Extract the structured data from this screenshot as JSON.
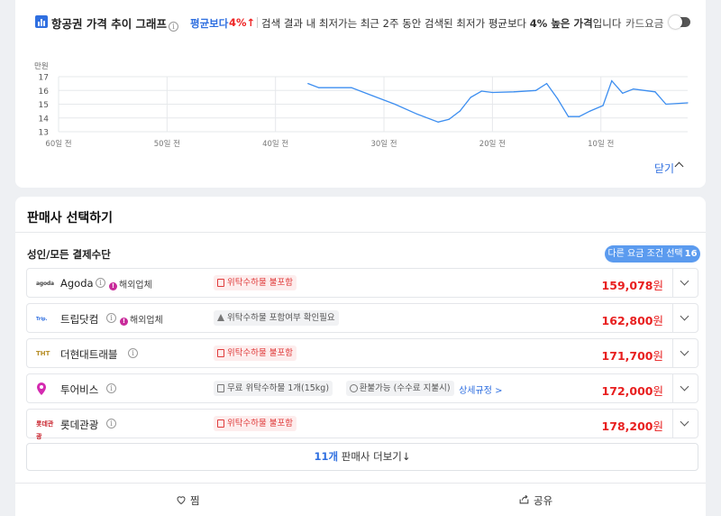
{
  "chart_section": {
    "title": "항공권 가격 추이 그래프",
    "compare_label": "평균보다",
    "compare_pct": "4%↑",
    "compare_desc_pre": "검색 결과 내 최저가는 최근 2주 동안 검색된 최저가 평균보다 ",
    "compare_desc_bold": "4% 높은 가격",
    "compare_desc_post": "입니다",
    "card_fee_label": "카드요금",
    "card_fee_toggle": "off",
    "close_label": "닫기",
    "colors": {
      "accent": "#2f6fe0",
      "up": "#e22222",
      "line": "#3d8ef0"
    }
  },
  "chart_data": {
    "type": "line",
    "title": "",
    "xlabel": "",
    "ylabel": "만원",
    "x_ticks": [
      "60일 전",
      "50일 전",
      "40일 전",
      "30일 전",
      "20일 전",
      "10일 전"
    ],
    "x_tick_values": [
      60,
      50,
      40,
      30,
      20,
      10
    ],
    "xlim": [
      60,
      2
    ],
    "y_ticks": [
      13,
      14,
      15,
      16,
      17
    ],
    "ylim": [
      13,
      17
    ],
    "grid": true,
    "series": [
      {
        "x": [
          37,
          36,
          33,
          31,
          29,
          27,
          25,
          24,
          23,
          22,
          21,
          20,
          18,
          16,
          15,
          14,
          13,
          12,
          11,
          9.8,
          9,
          8,
          7,
          5,
          4,
          2
        ],
        "values": [
          16.5,
          16.2,
          16.2,
          15.6,
          15.0,
          14.3,
          13.7,
          13.9,
          14.5,
          15.5,
          15.95,
          15.85,
          15.9,
          16.0,
          16.5,
          15.4,
          14.1,
          14.1,
          14.5,
          14.9,
          16.7,
          15.8,
          16.1,
          15.9,
          15.0,
          15.1
        ]
      }
    ]
  },
  "sellers": {
    "title": "판매사 선택하기",
    "payment_label": "성인/모든 결제수단",
    "filter_label": "다른 요금 조건 선택",
    "filter_count": "16",
    "rows": [
      {
        "logo": "agoda",
        "logo_color": "#333",
        "name": "Agoda",
        "foreign": "해외업체",
        "chips": [
          {
            "kind": "red",
            "icon": "box",
            "text": "위탁수하물 불포함"
          }
        ],
        "price": "159,078",
        "won": "원"
      },
      {
        "logo": "Trip.",
        "logo_color": "#2f6fe0",
        "name": "트립닷컴",
        "foreign": "해외업체",
        "chips": [
          {
            "kind": "gray",
            "icon": "tri",
            "text": "위탁수하물 포함여부 확인필요"
          }
        ],
        "price": "162,800",
        "won": "원"
      },
      {
        "logo": "THT",
        "logo_color": "#b8902a",
        "name": "더현대트래블",
        "foreign": "",
        "chips": [
          {
            "kind": "red",
            "icon": "box",
            "text": "위탁수하물 불포함"
          }
        ],
        "price": "171,700",
        "won": "원"
      },
      {
        "logo": "pin",
        "logo_color": "#c82aa0",
        "name": "투어비스",
        "foreign": "",
        "chips": [
          {
            "kind": "gray",
            "icon": "box",
            "text": "무료 위탁수하물 1개(15kg)"
          },
          {
            "kind": "gray",
            "icon": "circ",
            "text": "환불가능 (수수료 지불시)"
          }
        ],
        "link": "상세규정 >",
        "price": "172,000",
        "won": "원"
      },
      {
        "logo": "롯데관광",
        "logo_color": "#c8202a",
        "name": "롯데관광",
        "foreign": "",
        "chips": [
          {
            "kind": "red",
            "icon": "box",
            "text": "위탁수하물 불포함"
          }
        ],
        "price": "178,200",
        "won": "원"
      }
    ],
    "more_count": "11개",
    "more_label": " 판매사 더보기↓"
  },
  "bottom": {
    "wish_label": "찜",
    "share_label": "공유"
  }
}
